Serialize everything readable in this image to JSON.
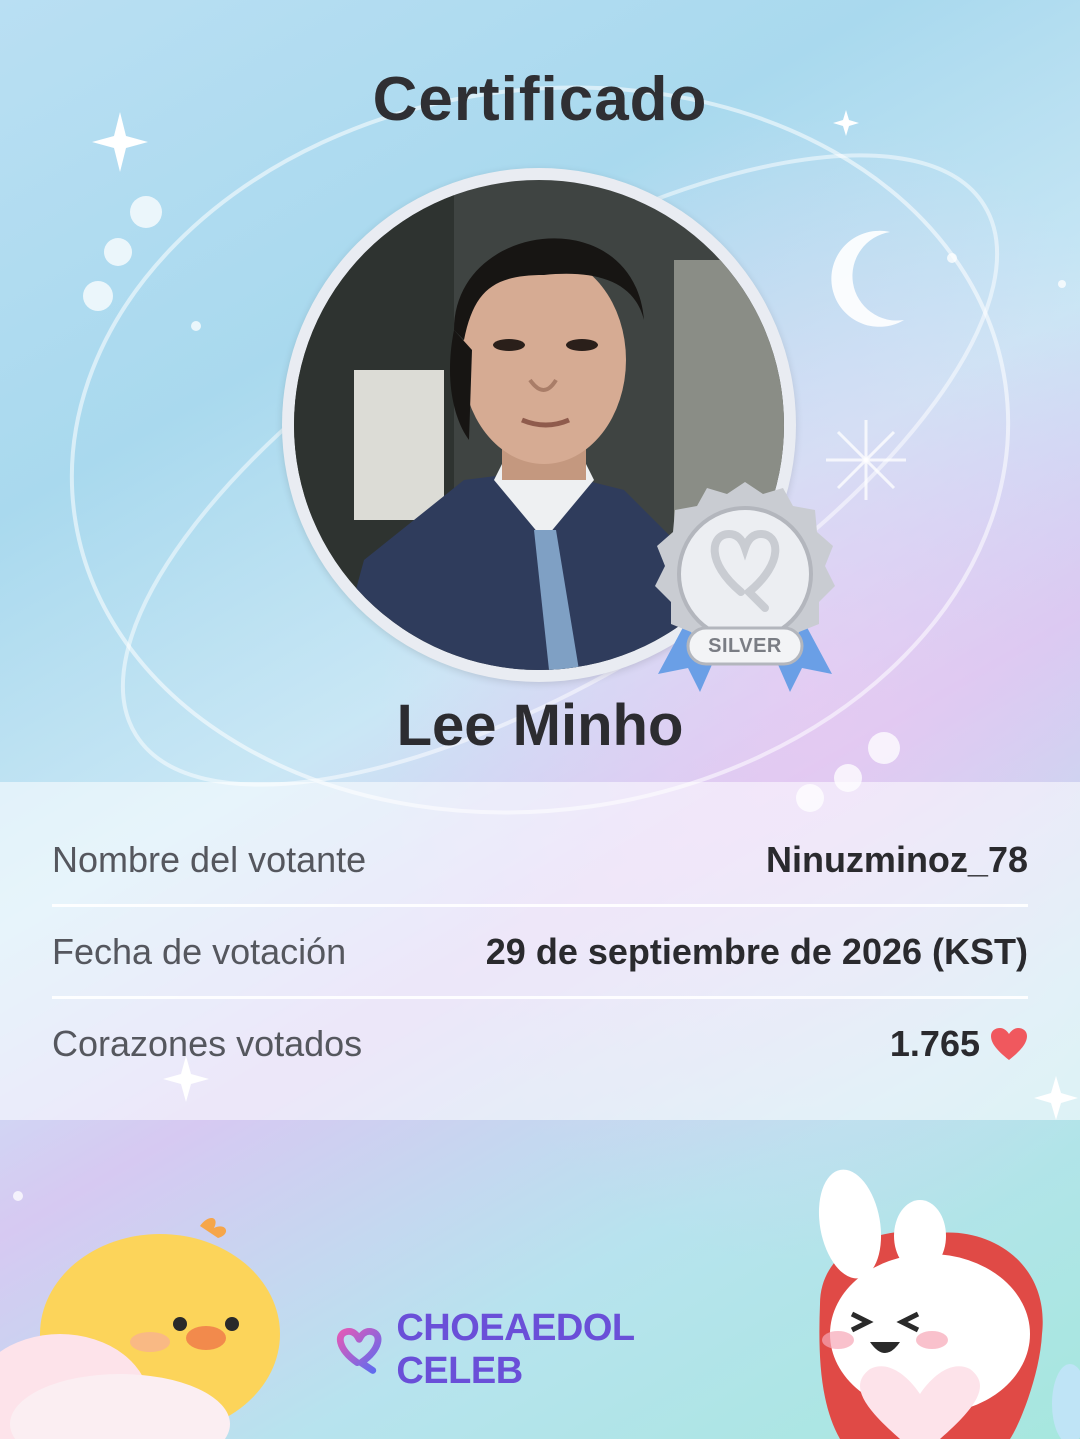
{
  "certificate": {
    "title": "Certificado",
    "celeb_name": "Lee Minho",
    "badge_label": "SILVER"
  },
  "info_rows": [
    {
      "label": "Nombre del votante",
      "value": "Ninuzminoz_78"
    },
    {
      "label": "Fecha de votación",
      "value": "29 de septiembre de 2026 (KST)"
    },
    {
      "label": "Corazones votados",
      "value": "1.765"
    }
  ],
  "brand": {
    "name": "CHOEAEDOL CELEB"
  },
  "colors": {
    "accent": "#6a4fd8",
    "heart": "#f0585e",
    "badge_silver": "#c9ccd2",
    "ribbon": "#6a9fe6"
  },
  "icons": [
    "sparkle-icon",
    "moon-icon",
    "heart-icon",
    "silver-medal-icon",
    "brand-logo-icon"
  ]
}
